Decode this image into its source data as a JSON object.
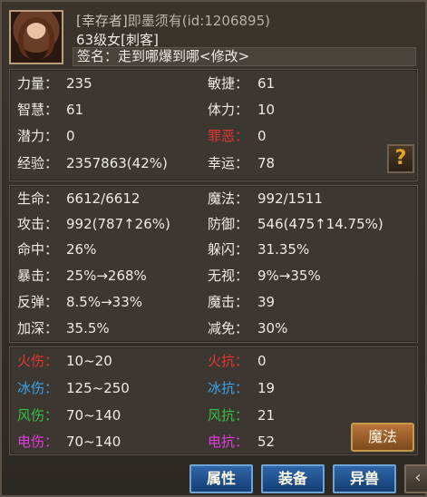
{
  "header": {
    "title_tag": "[幸存者]",
    "name": "即墨须有",
    "id_text": "(id:1206895)",
    "level_line": "63级女[刺客]",
    "signature_label": "签名：",
    "signature_text": "走到哪爆到哪<修改>"
  },
  "panel1": [
    {
      "l_label": "力量：",
      "l_value": "235",
      "r_label": "敏捷：",
      "r_value": "61",
      "r_color": "white"
    },
    {
      "l_label": "智慧：",
      "l_value": "61",
      "r_label": "体力：",
      "r_value": "10",
      "r_color": "white"
    },
    {
      "l_label": "潜力：",
      "l_value": "0",
      "r_label": "罪恶：",
      "r_value": "0",
      "r_color": "red"
    },
    {
      "l_label": "经验：",
      "l_value": "2357863(42%)",
      "r_label": "幸运：",
      "r_value": "78",
      "r_color": "white"
    }
  ],
  "help_icon": "?",
  "panel2": [
    {
      "l_label": "生命：",
      "l_value": "6612/6612",
      "r_label": "魔法：",
      "r_value": "992/1511"
    },
    {
      "l_label": "攻击：",
      "l_value": "992(787↑26%)",
      "r_label": "防御：",
      "r_value": "546(475↑14.75%)"
    },
    {
      "l_label": "命中：",
      "l_value": "26%",
      "r_label": "躲闪：",
      "r_value": "31.35%"
    },
    {
      "l_label": "暴击：",
      "l_value": "25%→268%",
      "r_label": "无视：",
      "r_value": "9%→35%"
    },
    {
      "l_label": "反弹：",
      "l_value": "8.5%→33%",
      "r_label": "魔击：",
      "r_value": "39"
    },
    {
      "l_label": "加深：",
      "l_value": "35.5%",
      "r_label": "减免：",
      "r_value": "30%"
    }
  ],
  "panel3": [
    {
      "l_label": "火伤：",
      "l_value": "10~20",
      "r_label": "火抗：",
      "r_value": "0",
      "color": "red"
    },
    {
      "l_label": "冰伤：",
      "l_value": "125~250",
      "r_label": "冰抗：",
      "r_value": "19",
      "color": "blue"
    },
    {
      "l_label": "风伤：",
      "l_value": "70~140",
      "r_label": "风抗：",
      "r_value": "21",
      "color": "green"
    },
    {
      "l_label": "电伤：",
      "l_value": "70~140",
      "r_label": "电抗：",
      "r_value": "52",
      "color": "pink"
    }
  ],
  "buttons": {
    "magic": "魔法",
    "tab_attr": "属性",
    "tab_equip": "装备",
    "tab_pet": "异兽",
    "arrow": "‹"
  },
  "colors": {
    "red": "#e2382d",
    "blue": "#37a4ef",
    "green": "#39c046",
    "pink": "#e43ae0",
    "white": "#ecebe6"
  }
}
